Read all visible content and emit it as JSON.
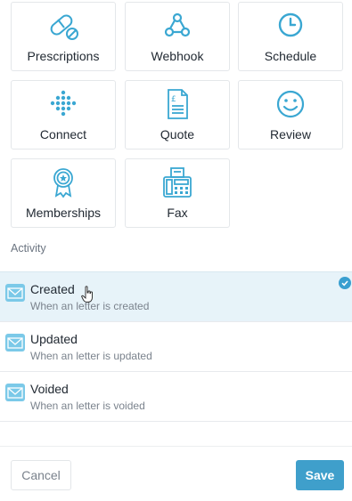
{
  "tiles": [
    {
      "label": "Prescriptions",
      "icon": "pill-icon"
    },
    {
      "label": "Webhook",
      "icon": "webhook-icon"
    },
    {
      "label": "Schedule",
      "icon": "clock-icon"
    },
    {
      "label": "Connect",
      "icon": "connect-dots-icon"
    },
    {
      "label": "Quote",
      "icon": "quote-document-icon"
    },
    {
      "label": "Review",
      "icon": "smiley-icon"
    },
    {
      "label": "Memberships",
      "icon": "badge-ribbon-icon"
    },
    {
      "label": "Fax",
      "icon": "fax-machine-icon"
    }
  ],
  "activity": {
    "section_label": "Activity",
    "items": [
      {
        "title": "Created",
        "subtitle": "When an letter is created",
        "selected": true
      },
      {
        "title": "Updated",
        "subtitle": "When an letter is updated",
        "selected": false
      },
      {
        "title": "Voided",
        "subtitle": "When an letter is voided",
        "selected": false
      }
    ]
  },
  "footer": {
    "cancel_label": "Cancel",
    "save_label": "Save"
  },
  "colors": {
    "accent": "#3f9fcb",
    "icon": "#3aa7d2",
    "selected_row_bg": "#e7f3f9"
  }
}
